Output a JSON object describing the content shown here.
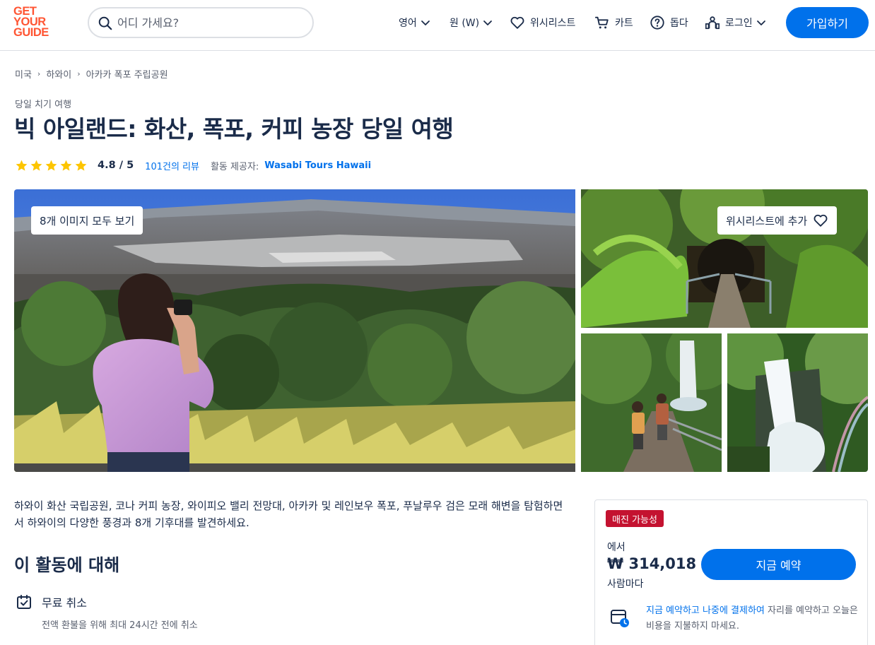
{
  "header": {
    "logo_lines": [
      "GET",
      "YOUR",
      "GUIDE"
    ],
    "search_placeholder": "어디 가세요?",
    "language": "영어",
    "currency": "원 (W)",
    "wishlist": "위시리스트",
    "cart": "카트",
    "help": "돕다",
    "login": "로그인",
    "signup": "가입하기"
  },
  "breadcrumb": [
    "미국",
    "하와이",
    "아카카 폭포 주립공원"
  ],
  "category": "당일 치기 여행",
  "title": "빅 아일랜드: 화산, 폭포, 커피 농장 당일 여행",
  "rating": {
    "stars": 5,
    "value": "4.8 / 5",
    "reviews": "101건의 리뷰",
    "provider_label": "활동 제공자:",
    "provider": "Wasabi Tours Hawaii"
  },
  "gallery": {
    "see_all": "8개 이미지 모두 보기",
    "add_wishlist": "위시리스트에 추가"
  },
  "summary": "하와이 화산 국립공원, 코나 커피 농장, 와이피오 밸리 전망대, 아카카 및 레인보우 폭포, 푸날루우 검은 모래 해변을 탐험하면서 하와이의 다양한 풍경과 8개 기후대를 발견하세요.",
  "about": {
    "heading": "이 활동에 대해",
    "features": [
      {
        "title": "무료 취소",
        "subtitle": "전액 환불을 위해 최대 24시간 전에 취소"
      }
    ]
  },
  "booking": {
    "badge": "매진 가능성",
    "from": "에서",
    "price": "₩ 314,018",
    "per": "사람마다",
    "button": "지금 예약",
    "rnpl_link": "지금 예약하고 나중에 결제하여",
    "rnpl_text": " 자리를 예약하고 오늘은 비용을 지불하지 마세요."
  },
  "colors": {
    "brand_orange": "#ff5533",
    "primary_blue": "#0071eb",
    "badge_red": "#c41230",
    "text_dark": "#1a2b49",
    "star_yellow": "#fdc500"
  }
}
